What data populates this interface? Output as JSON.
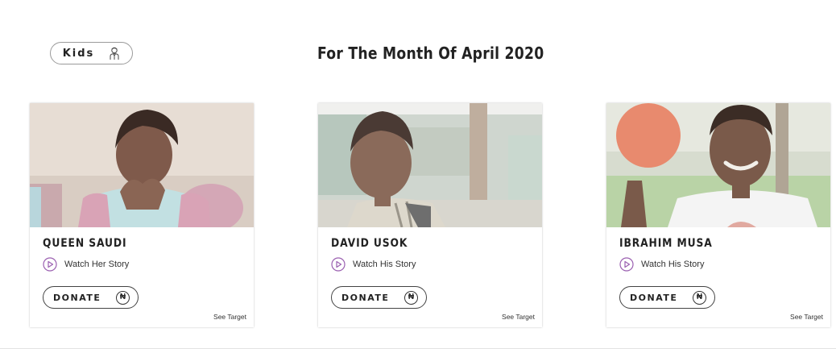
{
  "filter_pill": {
    "label": "Kids",
    "icon": "child-icon"
  },
  "heading": "For The Month Of April 2020",
  "cards": [
    {
      "name": "QUEEN SAUDI",
      "story_label": "Watch Her Story",
      "donate_label": "DONATE",
      "currency_symbol": "₦",
      "target_label": "See Target",
      "photo": "girl-praying-photo"
    },
    {
      "name": "DAVID USOK",
      "story_label": "Watch His Story",
      "donate_label": "DONATE",
      "currency_symbol": "₦",
      "target_label": "See Target",
      "photo": "boy-schoolbag-photo"
    },
    {
      "name": "IBRAHIM MUSA",
      "story_label": "Watch His Story",
      "donate_label": "DONATE",
      "currency_symbol": "₦",
      "target_label": "See Target",
      "photo": "boy-ball-photo"
    }
  ],
  "colors": {
    "play_icon": "#9a5fb0",
    "text": "#222222"
  }
}
